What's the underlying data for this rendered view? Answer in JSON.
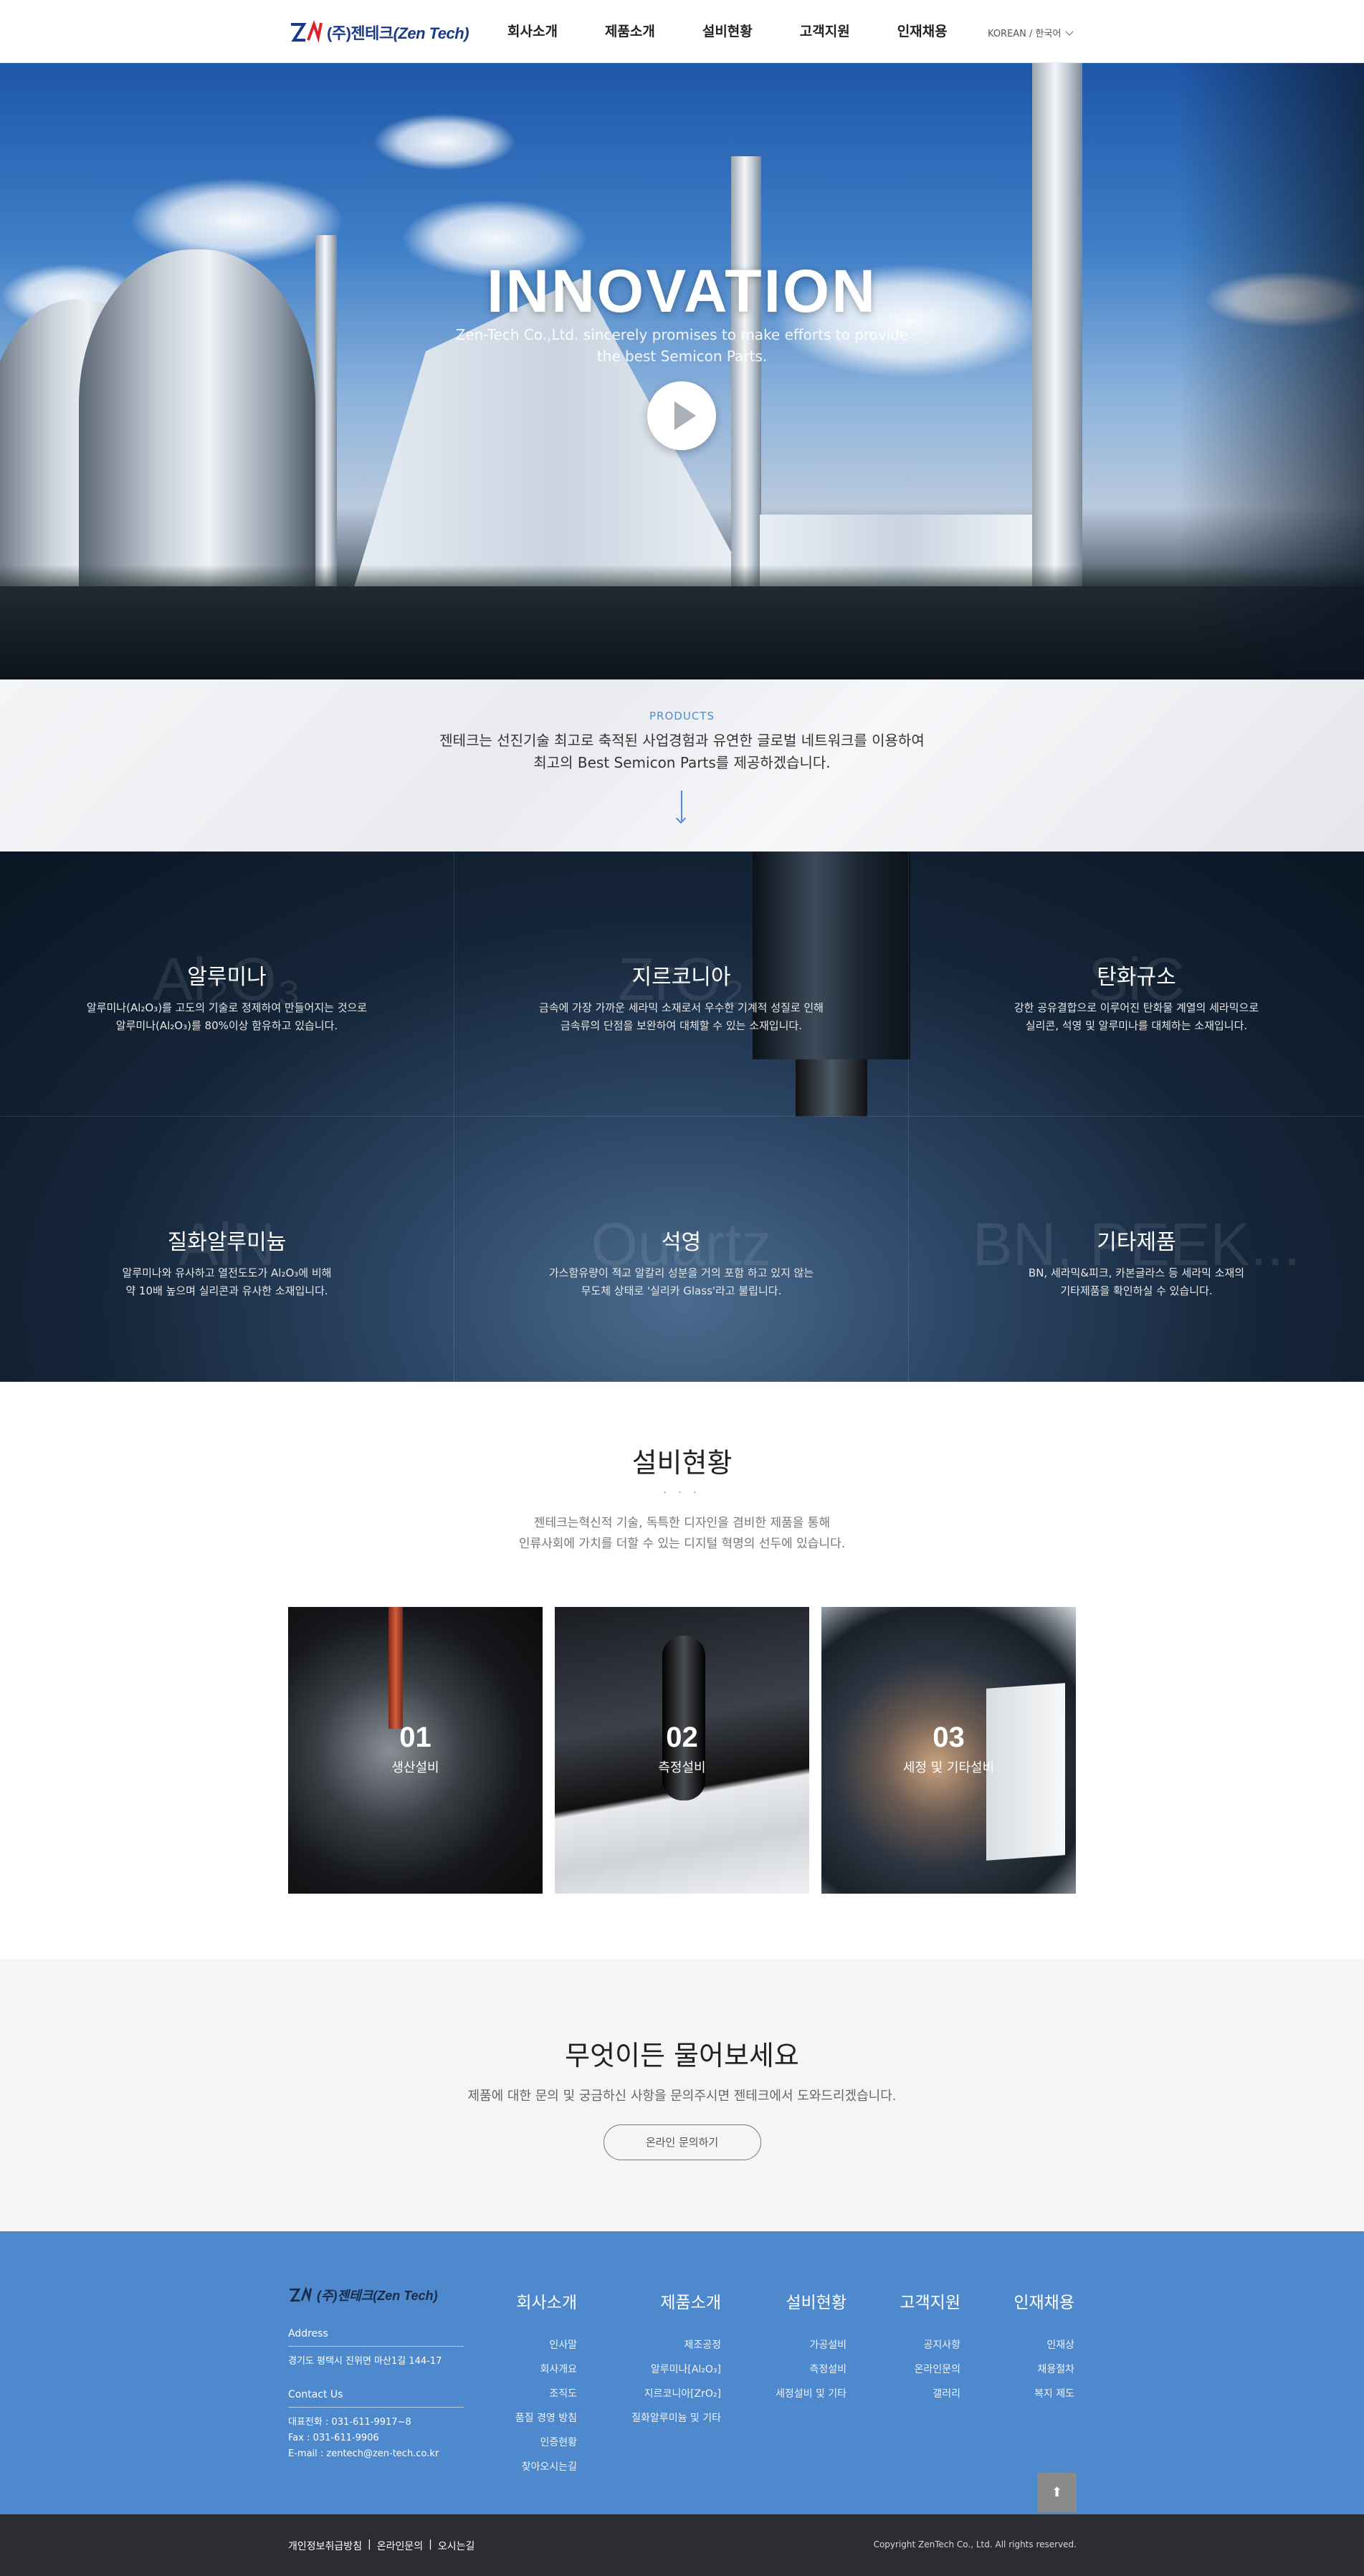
{
  "header": {
    "logo_text": "(주)젠테크",
    "logo_text_en": "(Zen Tech)",
    "nav": [
      "회사소개",
      "제품소개",
      "설비현황",
      "고객지원",
      "인재채용"
    ],
    "lang": "KOREAN / 한국어"
  },
  "hero": {
    "title": "INNOVATION",
    "sub_line1": "Zen-Tech Co.,Ltd. sincerely promises to make efforts to provide",
    "sub_line2": "the best Semicon Parts.",
    "play_icon": "play-icon"
  },
  "products": {
    "label": "PRODUCTS",
    "desc_line1": "젠테크는 선진기술 최고로 축적된 사업경험과 유연한 글로벌 네트워크를 이용하여",
    "desc_line2": "최고의 Best Semicon Parts를 제공하겠습니다.",
    "items": [
      {
        "title": "알루미나",
        "bg": "Al₂O₃",
        "line1": "알루미나(Al₂O₃)를 고도의 기술로 정제하여 만들어지는 것으로",
        "line2": "알루미나(Al₂O₃)를 80%이상 함유하고 있습니다."
      },
      {
        "title": "지르코니아",
        "bg": "ZrO₂",
        "line1": "금속에 가장 가까운 세라믹 소재로서 우수한 기계적 성질로 인해",
        "line2": "금속류의 단점을 보완하여 대체할 수 있는 소재입니다."
      },
      {
        "title": "탄화규소",
        "bg": "SiC",
        "line1": "강한 공유결합으로 이루어진 탄화물 계열의 세라믹으로",
        "line2": "실리콘, 석영 및 알루미나를 대체하는 소재입니다."
      },
      {
        "title": "질화알루미늄",
        "bg": "AlN",
        "line1": "알루미나와 유사하고 열전도도가 Al₂O₃에 비해",
        "line2": "약 10배 높으며 실리콘과 유사한 소재입니다."
      },
      {
        "title": "석영",
        "bg": "Quartz",
        "line1": "가스함유량이 적고 알칼리 성분을 거의 포함 하고 있지 않는",
        "line2": "무도체 상태로 '실리카 Glass'라고 불립니다."
      },
      {
        "title": "기타제품",
        "bg": "BN, PEEK...",
        "line1": "BN, 세라믹&피크, 카본글라스 등 세라믹 소재의",
        "line2": "기타제품을 확인하실 수 있습니다."
      }
    ]
  },
  "equipment": {
    "title": "설비현황",
    "dots": "· · ·",
    "desc_line1": "젠테크는혁신적 기술, 독특한 디자인을 겸비한 제품을 통해",
    "desc_line2": "인류사회에 가치를 더할 수 있는 디지털 혁명의 선두에 있습니다.",
    "cards": [
      {
        "num": "01",
        "name": "생산설비"
      },
      {
        "num": "02",
        "name": "측정설비"
      },
      {
        "num": "03",
        "name": "세정 및 기타설비"
      }
    ]
  },
  "inquiry": {
    "title": "무엇이든 물어보세요",
    "desc": "제품에 대한 문의 및 궁금하신 사항을 문의주시면 젠테크에서 도와드리겠습니다.",
    "button": "온라인 문의하기"
  },
  "footer": {
    "logo_text": "(주)젠테크(Zen Tech)",
    "address_title": "Address",
    "address": "경기도 평택시 진위면 마산1길 144-17",
    "contact_title": "Contact Us",
    "tel": "대표전화 : 031-611-9917~8",
    "fax": "Fax : 031-611-9906",
    "email": "E-mail : zentech@zen-tech.co.kr",
    "columns": [
      {
        "title": "회사소개",
        "links": [
          "인사말",
          "회사개요",
          "조직도",
          "품질 경영 방침",
          "인증현황",
          "찾아오시는길"
        ]
      },
      {
        "title": "제품소개",
        "links": [
          "제조공정",
          "알루미나[Al₂O₃]",
          "지르코니아[ZrO₂]",
          "질화알루미늄 및 기타"
        ]
      },
      {
        "title": "설비현황",
        "links": [
          "가공설비",
          "측정설비",
          "세정설비 및 기타"
        ]
      },
      {
        "title": "고객지원",
        "links": [
          "공지사항",
          "온라인문의",
          "갤러리"
        ]
      },
      {
        "title": "인재채용",
        "links": [
          "인재상",
          "채용절차",
          "복지 제도"
        ]
      }
    ],
    "top_button": "⬆"
  },
  "bottom": {
    "links": [
      "개인정보취급방침",
      "온라인문의",
      "오시는길"
    ],
    "sep": "|",
    "copyright": "Copyright ZenTech Co., Ltd. All rights reserved."
  }
}
